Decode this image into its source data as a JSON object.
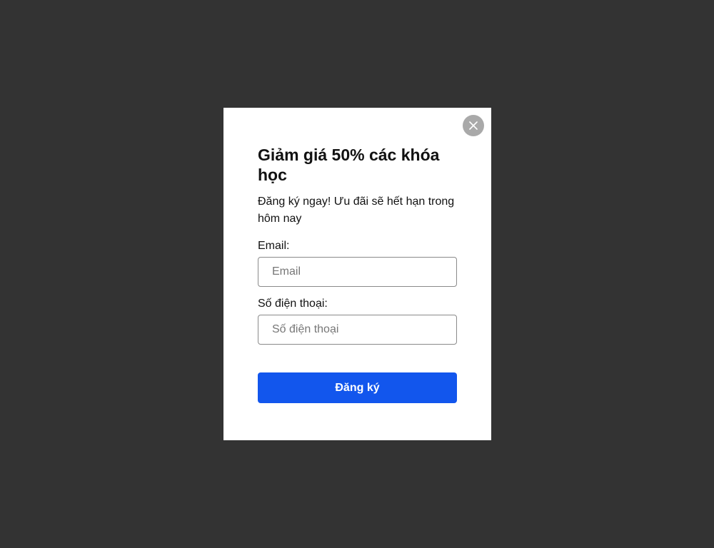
{
  "colors": {
    "backdrop": "#333333",
    "modal_background": "#ffffff",
    "close_button": "#a9a9a9",
    "primary_button": "#1256ed",
    "text": "#111111"
  },
  "modal": {
    "close_icon": "close-icon",
    "title": "Giảm giá 50% các khóa học",
    "subtitle": "Đăng ký ngay! Ưu đãi sẽ hết hạn trong hôm nay",
    "form": {
      "email_label": "Email:",
      "email_placeholder": "Email",
      "email_value": "",
      "phone_label": "Số điện thoại:",
      "phone_placeholder": "Số điện thoại",
      "phone_value": "",
      "submit_label": "Đăng ký"
    }
  }
}
